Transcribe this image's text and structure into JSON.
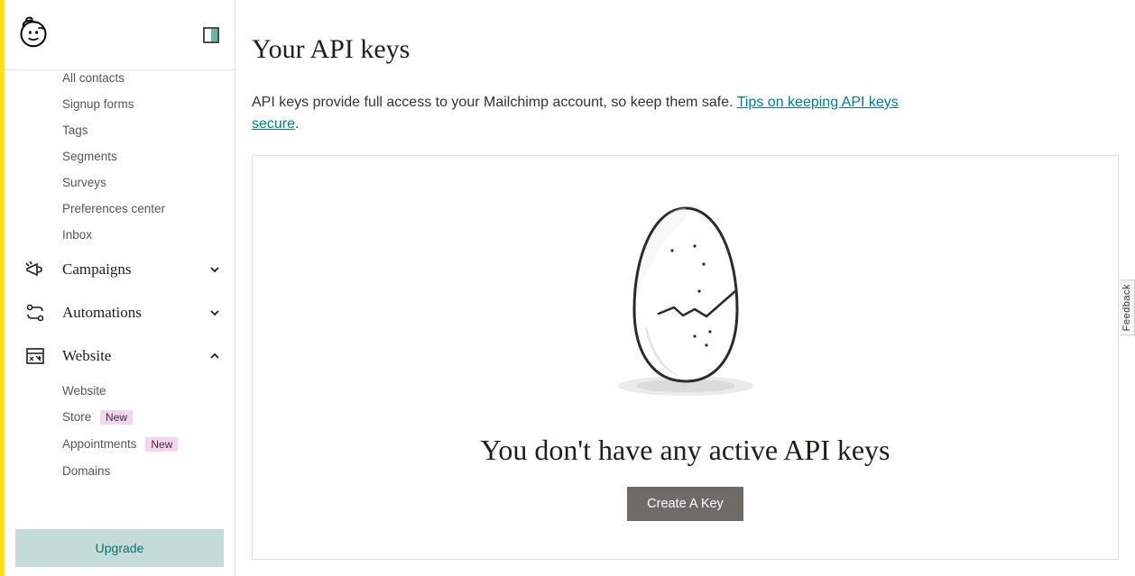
{
  "sidebar": {
    "subitems_top": [
      {
        "label": "All contacts"
      },
      {
        "label": "Signup forms"
      },
      {
        "label": "Tags"
      },
      {
        "label": "Segments"
      },
      {
        "label": "Surveys"
      },
      {
        "label": "Preferences center"
      },
      {
        "label": "Inbox"
      }
    ],
    "campaigns": {
      "label": "Campaigns"
    },
    "automations": {
      "label": "Automations"
    },
    "website": {
      "label": "Website",
      "subitems": [
        {
          "label": "Website",
          "badge": null
        },
        {
          "label": "Store",
          "badge": "New"
        },
        {
          "label": "Appointments",
          "badge": "New"
        },
        {
          "label": "Domains",
          "badge": null
        }
      ]
    },
    "upgrade_label": "Upgrade"
  },
  "main": {
    "title": "Your API keys",
    "desc_prefix": "API keys provide full access to your Mailchimp account, so keep them safe. ",
    "link_text": "Tips on keeping API keys secure",
    "desc_suffix": ".",
    "empty_title": "You don't have any active API keys",
    "create_label": "Create A Key"
  },
  "feedback_label": "Feedback"
}
